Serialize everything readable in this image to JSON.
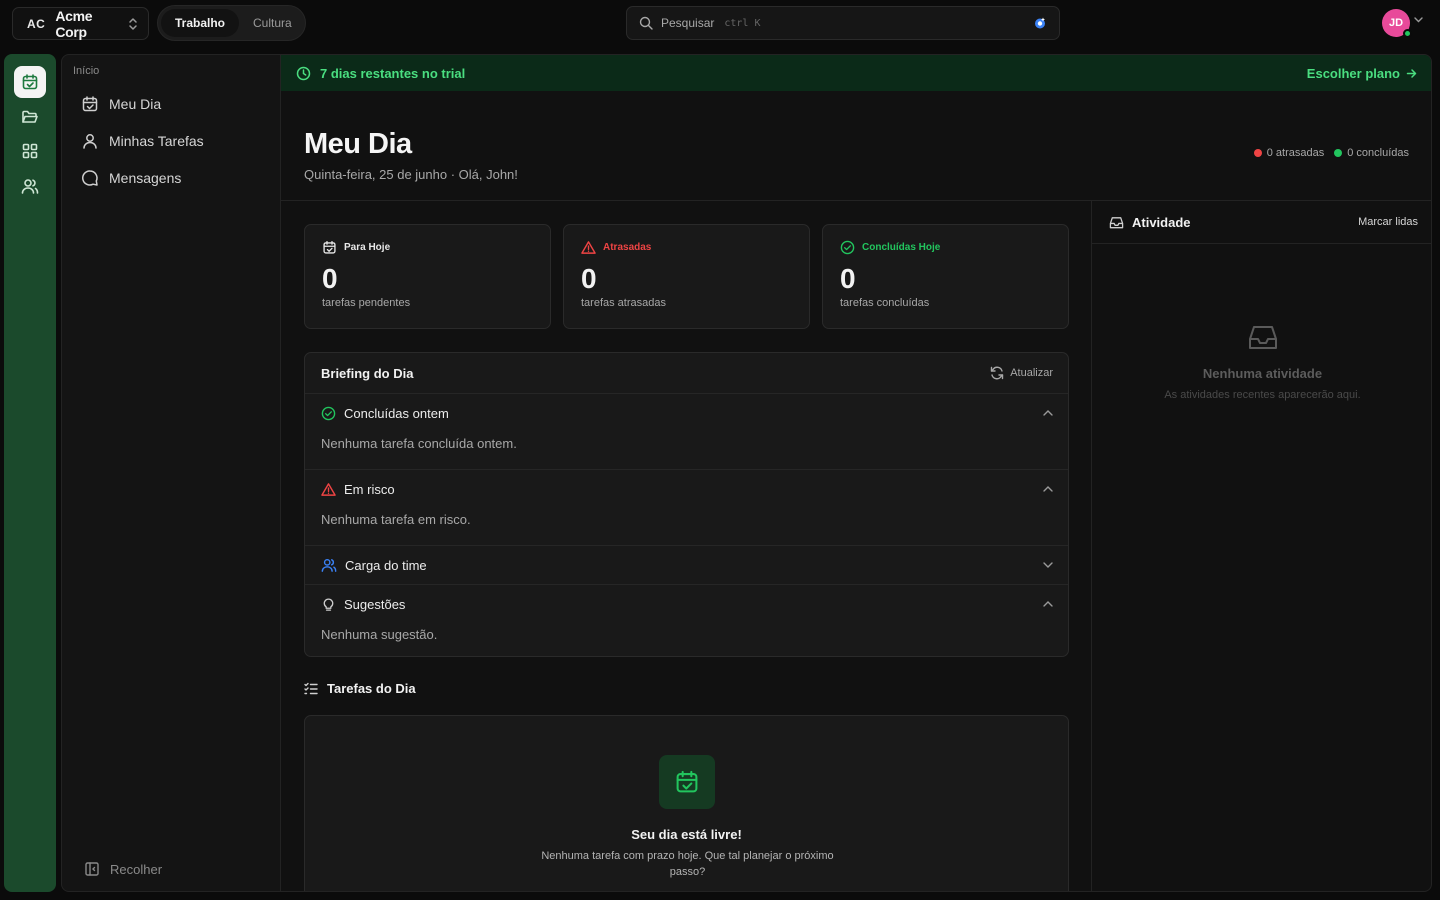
{
  "org": {
    "initials": "AC",
    "name": "Acme Corp"
  },
  "workspaces": [
    {
      "label": "Trabalho"
    },
    {
      "label": "Cultura"
    }
  ],
  "search": {
    "placeholder": "Pesquisar",
    "shortcut": "ctrl K"
  },
  "user": {
    "initials": "JD"
  },
  "nav": {
    "section": "Início",
    "items": [
      {
        "label": "Meu Dia",
        "icon": "calendar-check-icon"
      },
      {
        "label": "Minhas Tarefas",
        "icon": "user-icon"
      },
      {
        "label": "Mensagens",
        "icon": "message-circle-icon"
      }
    ],
    "collapse": "Recolher"
  },
  "trial": {
    "text": "7 dias restantes no trial",
    "cta": "Escolher plano"
  },
  "page": {
    "title": "Meu Dia",
    "subtitle": "Quinta-feira, 25 de junho · Olá, John!"
  },
  "stats": {
    "overdue": "0 atrasadas",
    "done": "0 concluídas",
    "overdue_color": "#ef4444",
    "done_color": "#22c55e"
  },
  "cards": [
    {
      "title": "Para Hoje",
      "value": "0",
      "label": "tarefas pendentes",
      "color": "#e8e8e8"
    },
    {
      "title": "Atrasadas",
      "value": "0",
      "label": "tarefas atrasadas",
      "color": "#ef4444"
    },
    {
      "title": "Concluídas Hoje",
      "value": "0",
      "label": "tarefas concluídas",
      "color": "#22c55e"
    }
  ],
  "briefing": {
    "title": "Briefing do Dia",
    "refresh": "Atualizar",
    "sections": [
      {
        "title": "Concluídas ontem",
        "body": "Nenhuma tarefa concluída ontem."
      },
      {
        "title": "Em risco",
        "body": "Nenhuma tarefa em risco."
      },
      {
        "title": "Carga do time"
      },
      {
        "title": "Sugestões",
        "body": "Nenhuma sugestão."
      }
    ]
  },
  "tasks": {
    "title": "Tarefas do Dia",
    "empty_title": "Seu dia está livre!",
    "empty_subtitle": "Nenhuma tarefa com prazo hoje. Que tal planejar o próximo passo?"
  },
  "activity": {
    "title": "Atividade",
    "mark_read": "Marcar lidas",
    "empty_title": "Nenhuma atividade",
    "empty_subtitle": "As atividades recentes aparecerão aqui."
  },
  "colors": {
    "accent": "#4ade80",
    "rail": "#1b4a2c"
  }
}
